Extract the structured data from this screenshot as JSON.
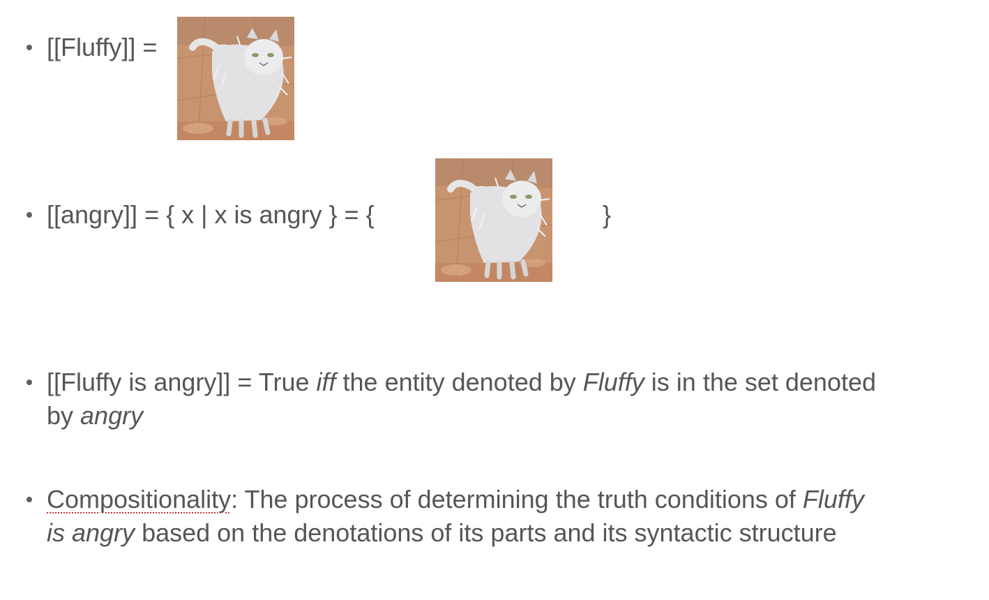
{
  "bullets": {
    "b1": {
      "text": "[[Fluffy]] ="
    },
    "b2": {
      "text_before": "[[angry]] = { x | x is angry } = {",
      "close_brace": "}"
    },
    "b3": {
      "part1": "[[Fluffy is angry]] = True ",
      "iff": "iff",
      "part2": " the entity denoted by ",
      "fluffy": "Fluffy",
      "part3": " is in the set denoted",
      "line2_by": "by ",
      "angry": "angry"
    },
    "b4": {
      "term": "Compositionality",
      "part1": ": The process of determining the truth conditions of ",
      "fluffy": "Fluffy",
      "line2_italic": "is angry",
      "line2_rest": " based on the denotations of its parts and its syntactic structure"
    }
  },
  "images": {
    "cat": {
      "icon": "wet-angry-cat-photo"
    }
  },
  "colors": {
    "text": "#555559",
    "squiggle": "#d03030"
  }
}
